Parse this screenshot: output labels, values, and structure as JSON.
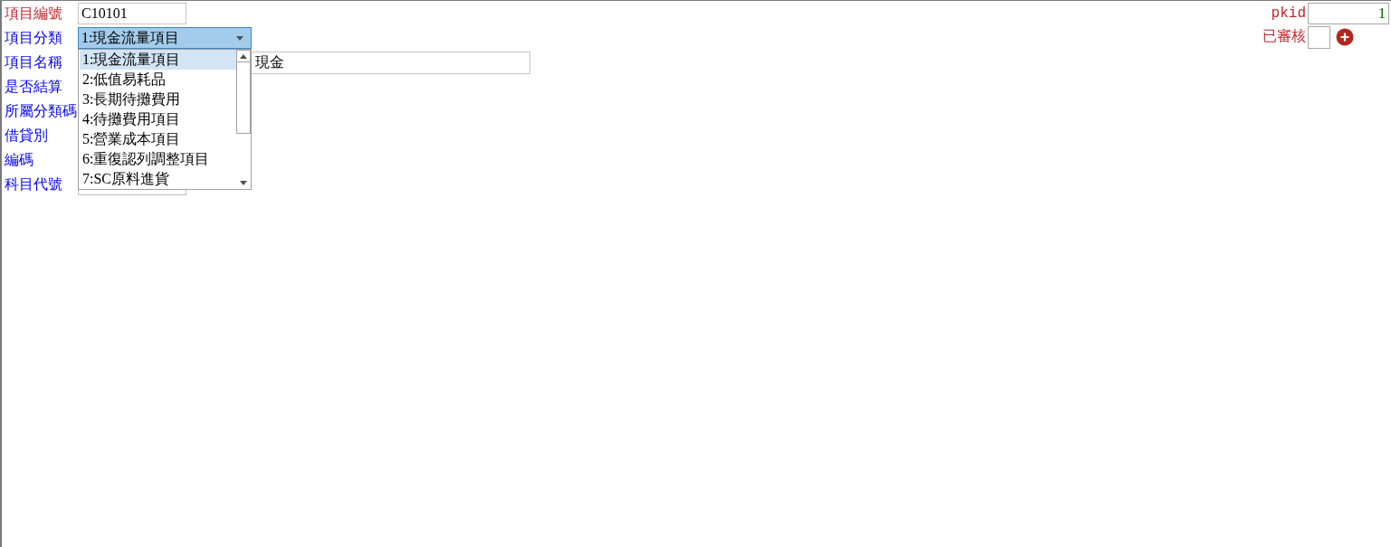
{
  "left_fields": [
    {
      "label": "項目編號",
      "color": "#c0282d",
      "kind": "text",
      "value": "C10101"
    },
    {
      "label": "項目分類",
      "color": "#0000ee",
      "kind": "select",
      "value": "1:現金流量項目",
      "expanded": true,
      "options": [
        {
          "label": "1:現金流量項目",
          "selected": true
        },
        {
          "label": "2:低值易耗品",
          "selected": false
        },
        {
          "label": "3:長期待攤費用",
          "selected": false
        },
        {
          "label": "4:待攤費用項目",
          "selected": false
        },
        {
          "label": "5:營業成本項目",
          "selected": false
        },
        {
          "label": "6:重復認列調整項目",
          "selected": false
        },
        {
          "label": "7:SC原料進貨",
          "selected": false
        }
      ]
    },
    {
      "label": "項目名稱",
      "color": "#0000ee",
      "kind": "wide_text",
      "value": "現金"
    },
    {
      "label": "是否結算",
      "color": "#0000ee"
    },
    {
      "label": "所屬分類碼",
      "color": "#0000ee"
    },
    {
      "label": "借貸別",
      "color": "#0000ee"
    },
    {
      "label": "編碼",
      "color": "#0000ee"
    },
    {
      "label": "科目代號",
      "color": "#0000ee",
      "kind": "text"
    }
  ],
  "right_fields": [
    {
      "label": "pkid",
      "color": "#c0282d",
      "kind": "number",
      "value": "1"
    },
    {
      "label": "已審核",
      "color": "#c0282d",
      "kind": "short_text",
      "add_button": true
    }
  ]
}
